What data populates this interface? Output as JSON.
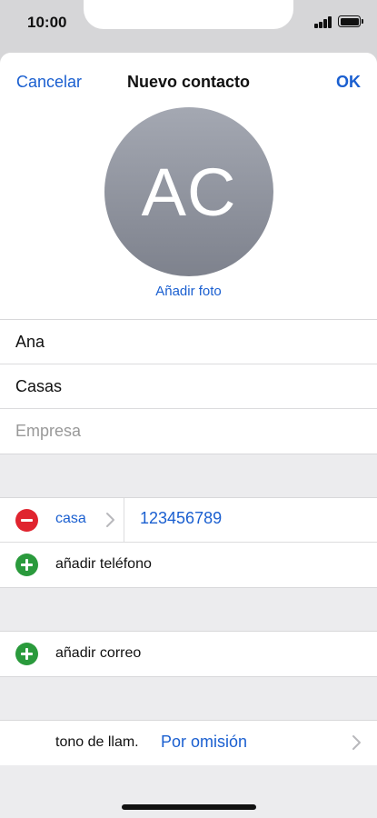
{
  "status": {
    "time": "10:00"
  },
  "nav": {
    "cancel": "Cancelar",
    "title": "Nuevo contacto",
    "ok": "OK"
  },
  "avatar": {
    "initials": "AC",
    "add_photo": "Añadir foto"
  },
  "fields": {
    "first_name": "Ana",
    "last_name": "Casas",
    "company_placeholder": "Empresa"
  },
  "phone": {
    "label": "casa",
    "number": "123456789",
    "add_label": "añadir teléfono"
  },
  "email": {
    "add_label": "añadir correo"
  },
  "ringtone": {
    "label": "tono de llam.",
    "value": "Por omisión"
  },
  "colors": {
    "accent": "#1a5fd0",
    "remove": "#e0242f",
    "add": "#2a9a3c"
  }
}
